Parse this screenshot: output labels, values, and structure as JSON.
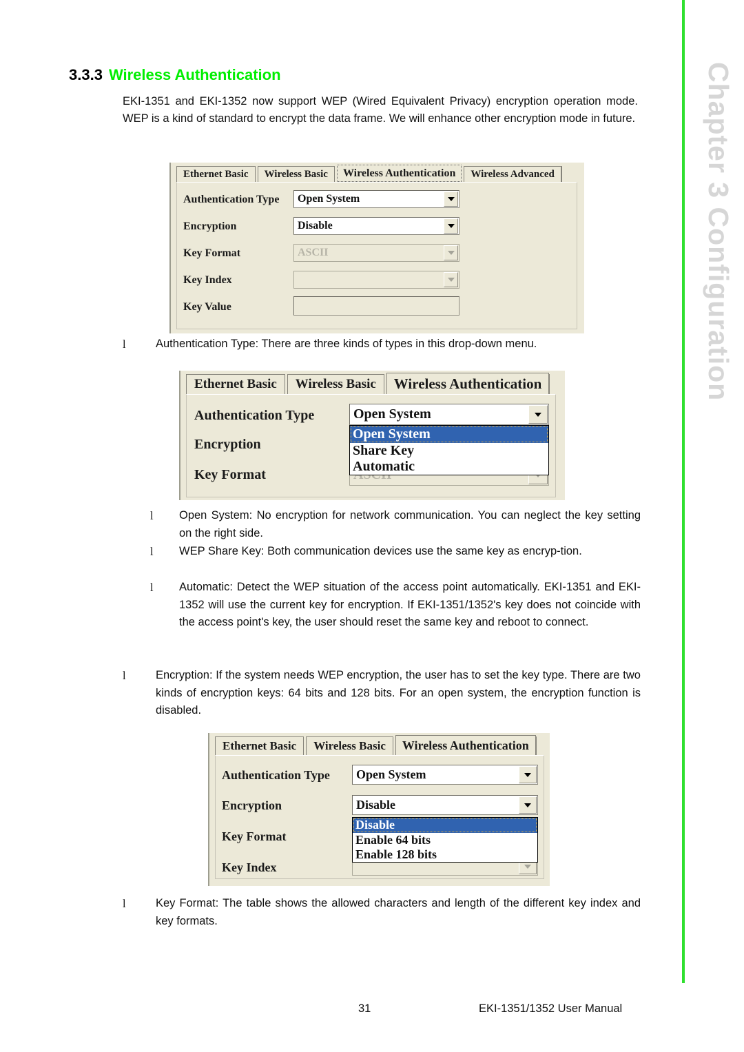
{
  "heading": {
    "number": "3.3.3",
    "title": "Wireless Authentication"
  },
  "intro": "EKI-1351 and EKI-1352 now support WEP (Wired Equivalent Privacy) encryption operation mode. WEP is a kind of standard to encrypt the data frame. We will enhance other encryption mode in future.",
  "bullets": {
    "mark": "l",
    "auth_type": "Authentication Type: There are three kinds of types in this drop-down menu.",
    "open_system": "Open System: No encryption for network communication. You can neglect the key setting on the right side.",
    "share_key": "WEP Share Key: Both communication devices use the same key as encryp-tion.",
    "automatic": "Automatic: Detect the WEP situation of the access point automatically. EKI-1351 and EKI-1352 will use the current key for encryption. If EKI-1351/1352's key does not coincide with the access point's key, the user should reset the same key and reboot to connect.",
    "encryption": "Encryption: If the system needs WEP encryption, the user has to set the key type. There are two kinds of encryption keys: 64 bits and 128 bits. For an open system, the encryption function is disabled.",
    "key_format": "Key Format: The table shows the allowed characters and length of the different key index and key formats."
  },
  "screenshot1": {
    "tabs": [
      "Ethernet Basic",
      "Wireless Basic",
      "Wireless Authentication",
      "Wireless Advanced"
    ],
    "selected_tab": "Wireless Authentication",
    "fields": {
      "auth_type_label": "Authentication Type",
      "auth_type_value": "Open System",
      "encryption_label": "Encryption",
      "encryption_value": "Disable",
      "key_format_label": "Key Format",
      "key_format_value": "ASCII",
      "key_index_label": "Key Index",
      "key_index_value": "",
      "key_value_label": "Key Value",
      "key_value_value": ""
    }
  },
  "screenshot2": {
    "tabs": [
      "Ethernet Basic",
      "Wireless Basic",
      "Wireless Authentication"
    ],
    "selected_tab": "Wireless Authentication",
    "fields": {
      "auth_type_label": "Authentication Type",
      "auth_type_value": "Open System",
      "encryption_label": "Encryption",
      "key_format_label": "Key Format",
      "key_format_value": "ASCII"
    },
    "dropdown_options": [
      "Open System",
      "Share Key",
      "Automatic"
    ],
    "dropdown_selected": "Open System"
  },
  "screenshot3": {
    "tabs": [
      "Ethernet Basic",
      "Wireless Basic",
      "Wireless Authentication"
    ],
    "selected_tab": "Wireless Authentication",
    "fields": {
      "auth_type_label": "Authentication Type",
      "auth_type_value": "Open System",
      "encryption_label": "Encryption",
      "encryption_value": "Disable",
      "key_format_label": "Key Format",
      "key_index_label": "Key Index"
    },
    "dropdown_options": [
      "Disable",
      "Enable 64 bits",
      "Enable 128 bits"
    ],
    "dropdown_selected": "Disable"
  },
  "rail": {
    "text": "Chapter 3   Configuration"
  },
  "footer": {
    "page_number": "31",
    "manual": "EKI-1351/1352 User Manual"
  },
  "colors": {
    "accent_green": "#00ee00",
    "rail_green": "#2fe02f",
    "rail_text": "#d6d6d6",
    "dialog_bg": "#ece9d8",
    "highlight_blue": "#3063b0"
  }
}
